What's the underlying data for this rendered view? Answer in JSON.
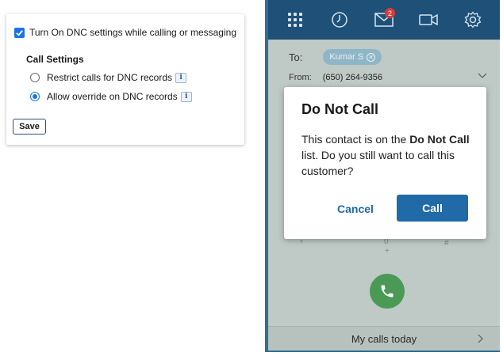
{
  "settings": {
    "dnc_checkbox_label": "Turn On DNC settings while calling or messaging",
    "dnc_checked": true,
    "call_settings_title": "Call Settings",
    "options": [
      {
        "label": "Restrict calls for DNC records",
        "selected": false
      },
      {
        "label": "Allow override on DNC records",
        "selected": true
      }
    ],
    "info_glyph": "i",
    "save_label": "Save"
  },
  "phone": {
    "toolbar_icons": [
      "dialpad-icon",
      "history-icon",
      "messages-icon",
      "video-icon",
      "settings-icon"
    ],
    "messages_badge": "2",
    "to_label": "To:",
    "recipient": "Kumar S",
    "from_label": "From:",
    "from_number": "(650) 264-9356",
    "dial_hints": [
      "*",
      "0",
      "+",
      "#"
    ],
    "bottom_label": "My calls today"
  },
  "modal": {
    "title": "Do Not Call",
    "body_prefix": "This contact is on the ",
    "body_bold": "Do Not Call",
    "body_suffix": " list. Do you still want to call this customer?",
    "cancel_label": "Cancel",
    "call_label": "Call"
  },
  "colors": {
    "accent": "#1a73e8",
    "toolbar": "#1e5078",
    "call_button": "#1f6aa7",
    "call_fab": "#4a9a55",
    "badge": "#d83a3a"
  }
}
